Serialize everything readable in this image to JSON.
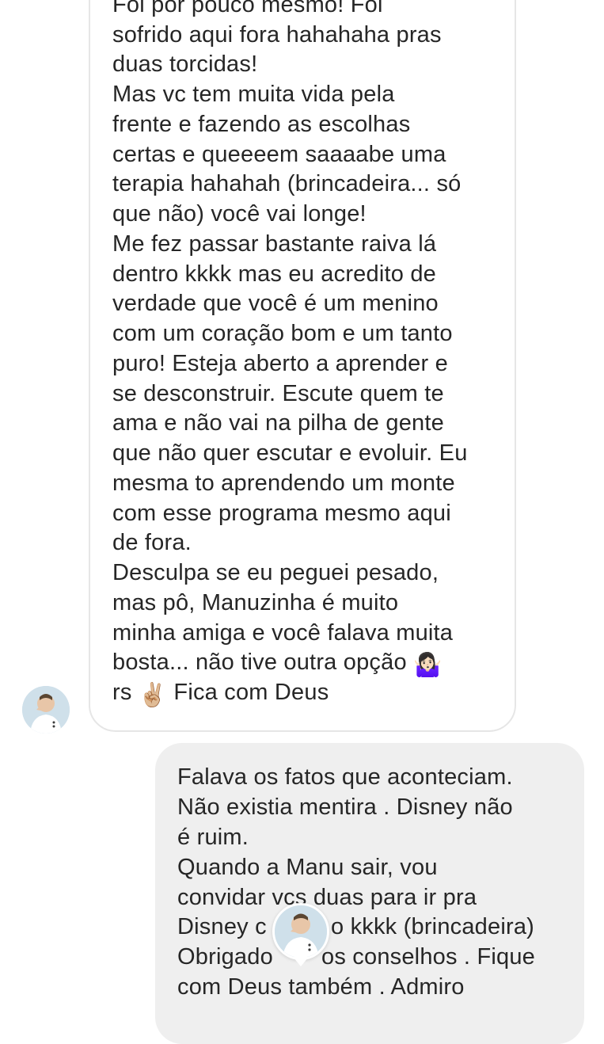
{
  "thread": {
    "incoming_message": {
      "lines": [
        "Foi por pouco mesmo! Foi",
        "sofrido aqui fora hahahaha pras",
        "duas torcidas!",
        "Mas vc tem muita vida pela",
        "frente e fazendo as escolhas",
        "certas e queeeem saaaabe uma",
        "terapia hahahah (brincadeira... só",
        "que não) você vai longe!",
        "Me fez passar bastante raiva lá",
        "dentro kkkk mas eu acredito de",
        "verdade que você é um menino",
        "com um coração bom e um tanto",
        "puro! Esteja aberto a aprender e",
        "se desconstruir. Escute quem te",
        "ama e não vai na pilha de gente",
        "que não quer escutar e evoluir. Eu",
        "mesma to aprendendo um monte",
        "com esse programa mesmo aqui",
        "de fora.",
        "Desculpa se eu peguei pesado,",
        "mas pô, Manuzinha é muito",
        "minha amiga e você falava muita",
        "bosta... não tive outra opção",
        "rs",
        "Fica com Deus"
      ],
      "emoji_shrug": "🤷🏻‍♀️",
      "emoji_victory": "✌🏼"
    },
    "outgoing_message": {
      "lines": [
        "Falava os fatos que aconteciam.",
        "Não existia mentira .  Disney não",
        "é  ruim.",
        "Quando a Manu sair, vou",
        "convidar vcs duas para ir pra",
        "Disney c",
        "o kkkk (brincadeira)",
        "Obrigado",
        "os conselhos . Fique",
        "com Deus também . Admiro"
      ]
    },
    "colors": {
      "incoming_bubble_border": "#e6e6e6",
      "outgoing_bubble_bg": "#efefef",
      "text": "#262626"
    },
    "icons": {
      "sender_avatar": "avatar-photo",
      "seen_avatar": "seen-avatar-photo"
    }
  }
}
